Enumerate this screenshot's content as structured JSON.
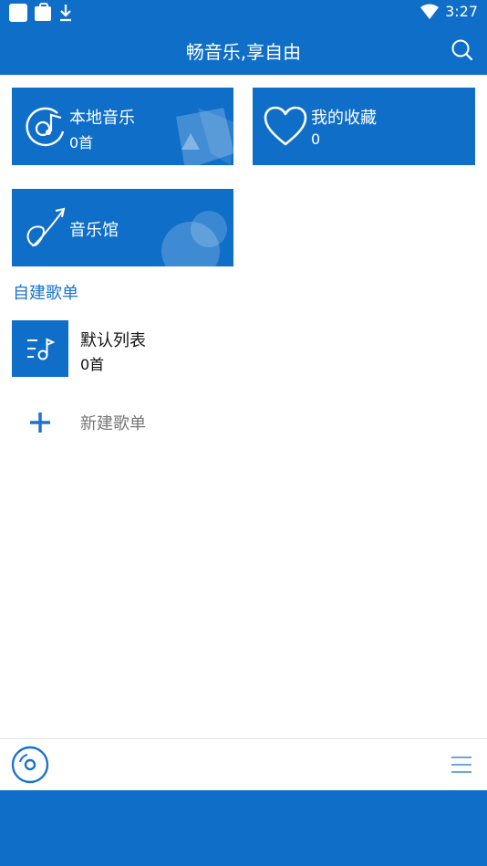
{
  "status_bar": {
    "time": "3:27",
    "icons": [
      "square-icon",
      "bag-icon",
      "download-icon",
      "wifi-icon"
    ]
  },
  "header": {
    "title": "畅音乐,享自由",
    "search_icon": "search-icon"
  },
  "cards": {
    "local": {
      "label": "本地音乐",
      "count": "0首",
      "icon": "music-disc-icon"
    },
    "favorites": {
      "label": "我的收藏",
      "count": "0",
      "icon": "heart-icon"
    },
    "hall": {
      "label": "音乐馆",
      "icon": "arrow-curve-icon"
    }
  },
  "section": {
    "title": "自建歌单"
  },
  "playlists": [
    {
      "name": "默认列表",
      "count": "0首",
      "icon": "playlist-icon"
    }
  ],
  "new_playlist": {
    "label": "新建歌单",
    "icon": "plus-icon"
  },
  "player": {
    "disc_icon": "disc-icon",
    "menu_icon": "menu-icon"
  },
  "colors": {
    "primary": "#0f6ec8",
    "section_text": "#1a73cc"
  }
}
